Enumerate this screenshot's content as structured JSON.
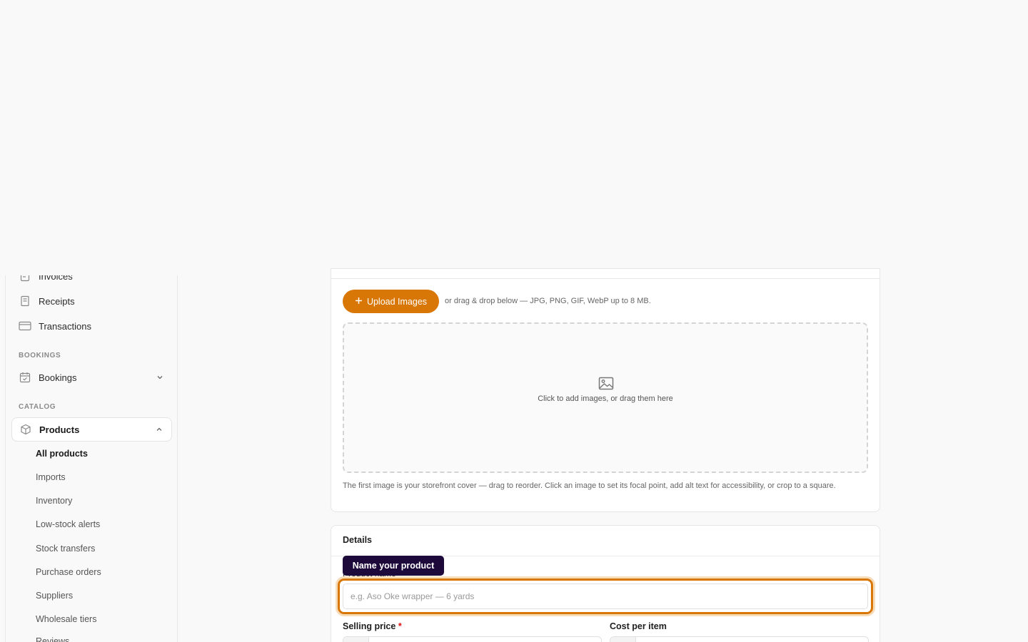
{
  "sidebar": {
    "items_top": [
      {
        "label": "Invoices",
        "icon": "invoice-icon"
      },
      {
        "label": "Receipts",
        "icon": "receipt-icon"
      },
      {
        "label": "Transactions",
        "icon": "card-icon"
      }
    ],
    "bookings_section": "BOOKINGS",
    "bookings_label": "Bookings",
    "catalog_section": "CATALOG",
    "products_label": "Products",
    "products_sub": [
      "All products",
      "Imports",
      "Inventory",
      "Low-stock alerts",
      "Stock transfers",
      "Purchase orders",
      "Suppliers",
      "Wholesale tiers",
      "Reviews"
    ]
  },
  "images_card": {
    "upload_label": "Upload Images",
    "upload_hint": "or drag & drop below — JPG, PNG, GIF, WebP up to 8 MB.",
    "dropzone_text": "Click to add images, or drag them here",
    "cover_note": "The first image is your storefront cover — drag to reorder. Click an image to set its focal point, add alt text for accessibility, or crop to a square."
  },
  "details_card": {
    "title": "Details",
    "product_name_label": "Product name",
    "tooltip": "Name your product",
    "product_name_placeholder": "e.g. Aso Oke wrapper — 6 yards",
    "selling_price_label": "Selling price",
    "required_mark": "*",
    "cost_label": "Cost per item"
  },
  "colors": {
    "accent": "#d97706",
    "tooltip_bg": "#1e0a3a"
  }
}
